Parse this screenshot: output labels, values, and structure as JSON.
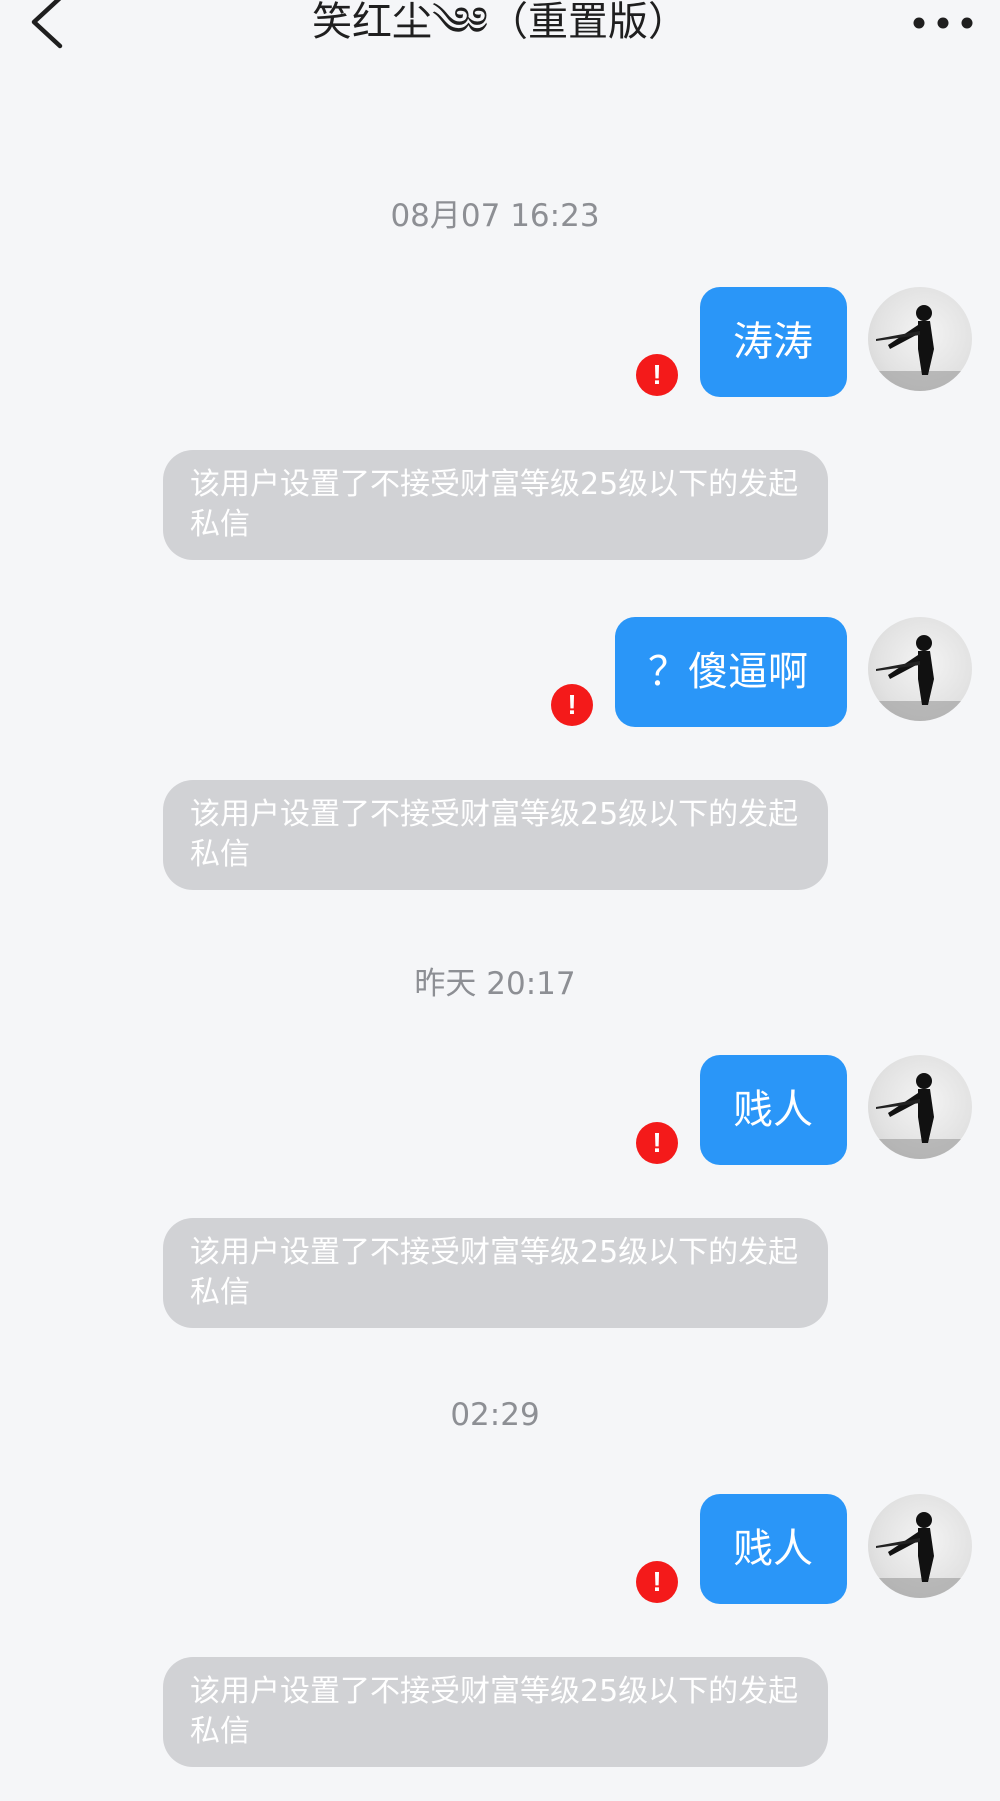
{
  "header": {
    "title": "笑红尘༄༅（重置版）",
    "back_icon": "chevron-left-icon",
    "more_icon": "more-horizontal-icon"
  },
  "colors": {
    "background": "#f5f6f8",
    "bubble_blue": "#2a96f8",
    "error_red": "#f41a1a",
    "notice_gray": "#d1d2d5"
  },
  "messages": [
    {
      "timestamp": "08月07 16:23",
      "text": "涛涛",
      "status": "!",
      "notice": "该用户设置了不接受财富等级25级以下的发起私信"
    },
    {
      "timestamp": "",
      "text": "？傻逼啊",
      "status": "!",
      "notice": "该用户设置了不接受财富等级25级以下的发起私信"
    },
    {
      "timestamp": "昨天 20:17",
      "text": "贱人",
      "status": "!",
      "notice": "该用户设置了不接受财富等级25级以下的发起私信"
    },
    {
      "timestamp": "02:29",
      "text": "贱人",
      "status": "!",
      "notice": "该用户设置了不接受财富等级25级以下的发起私信"
    }
  ]
}
